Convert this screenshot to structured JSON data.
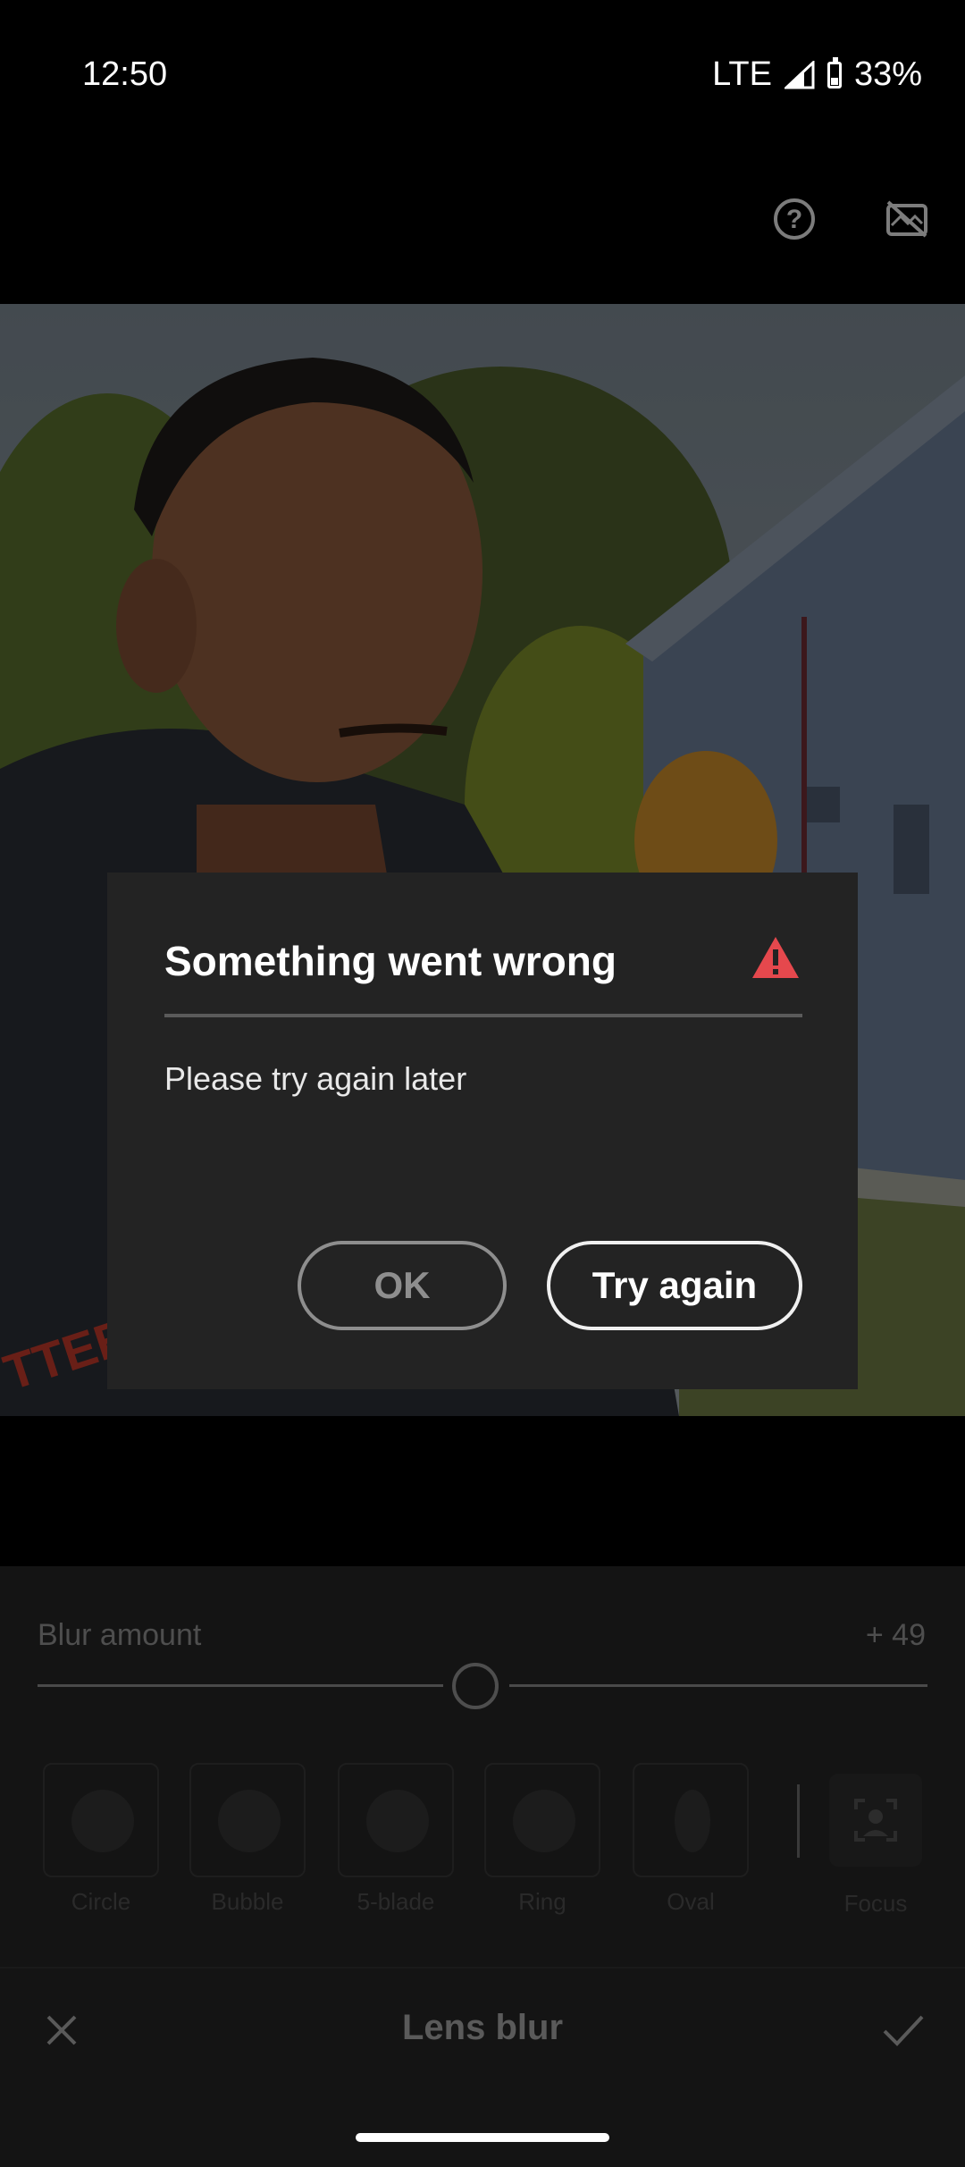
{
  "status_bar": {
    "time": "12:50",
    "network": "LTE",
    "battery": "33%"
  },
  "toolbar": {
    "help_icon": "question-circle-icon",
    "compare_icon": "eye-off-icon"
  },
  "panel": {
    "blur_label": "Blur amount",
    "blur_value": "+ 49",
    "blur_level": 49,
    "shapes": [
      {
        "label": "Circle"
      },
      {
        "label": "Bubble"
      },
      {
        "label": "5-blade"
      },
      {
        "label": "Ring"
      },
      {
        "label": "Oval"
      }
    ],
    "focus_label": "Focus"
  },
  "bottom_bar": {
    "title": "Lens blur"
  },
  "dialog": {
    "title": "Something went wrong",
    "message": "Please try again later",
    "ok_label": "OK",
    "try_again_label": "Try again",
    "warning_color": "#e5484d"
  }
}
